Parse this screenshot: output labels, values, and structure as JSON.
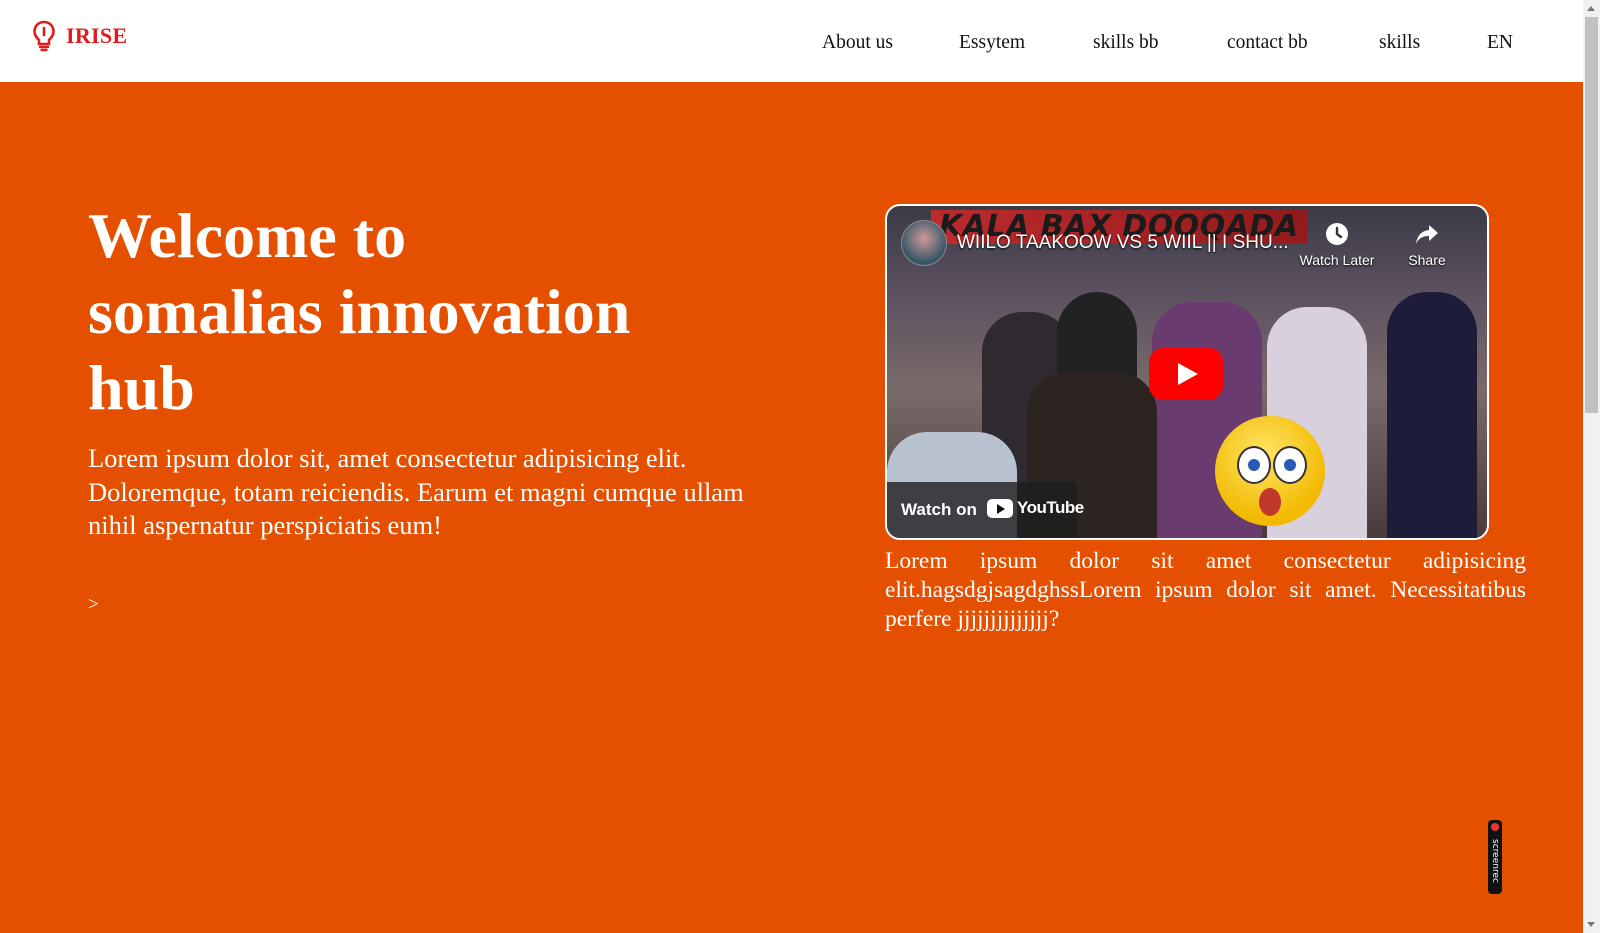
{
  "brand": {
    "name": "IRISE",
    "icon": "lightbulb-icon",
    "color": "#e01b1b"
  },
  "nav": {
    "items": [
      {
        "label": "About us"
      },
      {
        "label": "Essytem"
      },
      {
        "label": "skills bb"
      },
      {
        "label": "contact bb"
      },
      {
        "label": "skills"
      },
      {
        "label": "EN"
      }
    ]
  },
  "hero": {
    "background": "#e54f00",
    "title": "Welcome to somalias innovation hub",
    "text": "Lorem ipsum dolor sit, amet consectetur adipisicing elit. Doloremque, totam reiciendis. Earum et magni cumque ullam nihil aspernatur perspiciatis eum!",
    "arrow": ">"
  },
  "video": {
    "banner": "KALA BAX DOOQADA",
    "title": "WIILO TAAKOOW VS 5 WIIL || I SHU...",
    "watch_later": "Watch Later",
    "share": "Share",
    "watch_on": "Watch on",
    "youtube": "YouTube",
    "caption_main": "Lorem ipsum dolor sit amet consectetur adipisicing elit.hagsdgjsagdghssLorem ipsum dolor sit amet. Necessitatibus perfere ",
    "caption_link": "jjjjjjjjjjjjjj",
    "caption_end": "?"
  },
  "screenrec": {
    "label": "screenrec"
  }
}
